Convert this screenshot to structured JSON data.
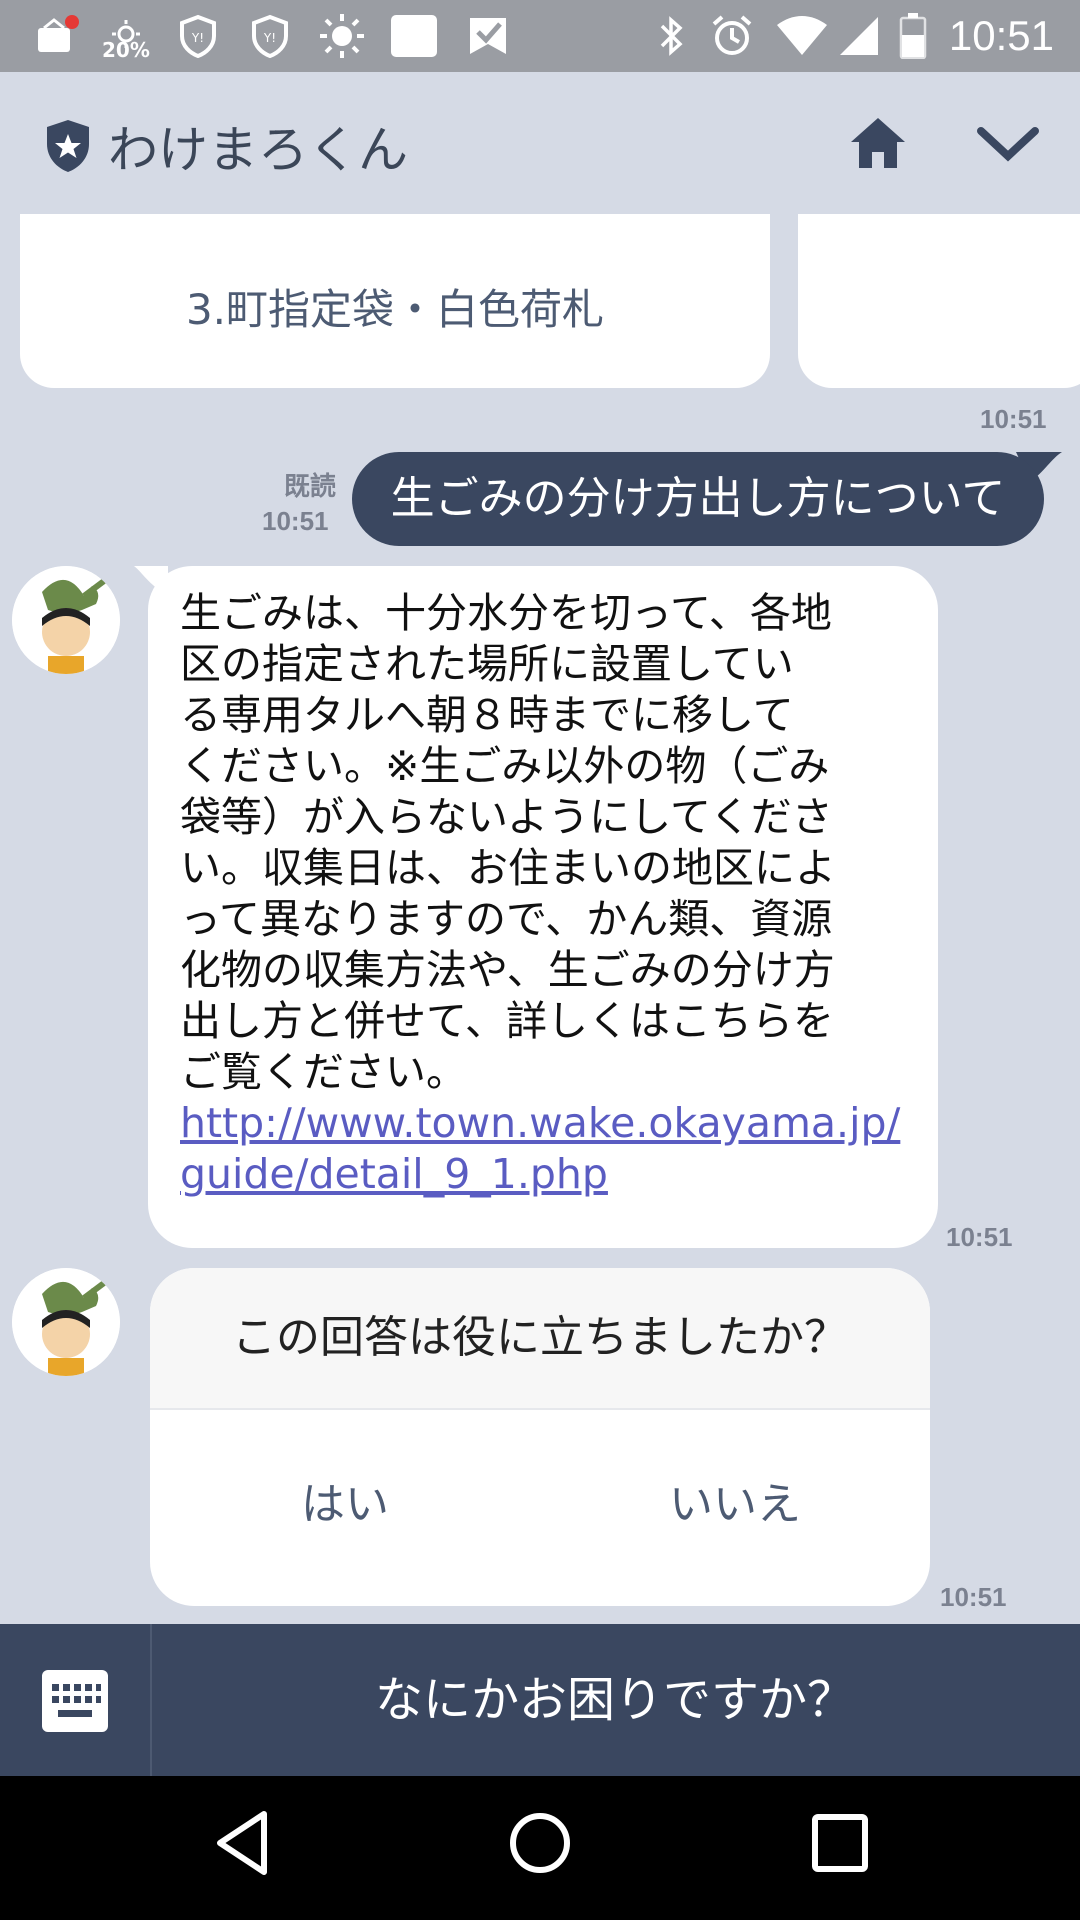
{
  "status_bar": {
    "battery_text": "20%",
    "time": "10:51"
  },
  "header": {
    "title": "わけまろくん"
  },
  "carousel": {
    "items": [
      {
        "label": "3.町指定袋・白色荷札"
      },
      {
        "label": ""
      }
    ],
    "time": "10:51"
  },
  "messages": {
    "outgoing": {
      "read_label": "既読",
      "time": "10:51",
      "text": "生ごみの分け方出し方について"
    },
    "incoming": {
      "text": "生ごみは、十分水分を切って、各地\n区の指定された場所に設置してい\nる専用タルへ朝８時までに移して\nください。※生ごみ以外の物（ごみ\n袋等）が入らないようにしてくださ\nい。収集日は、お住まいの地区によ\nって異なりますので、かん類、資源\n化物の収集方法や、生ごみの分け方\n出し方と併せて、詳しくはこちらを\nご覧ください。",
      "link_line1": "http://www.town.wake.okayama.jp/",
      "link_line2": "guide/detail_9_1.php",
      "time": "10:51"
    },
    "survey": {
      "question": "この回答は役に立ちましたか？",
      "yes": "はい",
      "no": "いいえ",
      "time": "10:51"
    }
  },
  "input_bar": {
    "prompt": "なにかお困りですか？"
  },
  "colors": {
    "accent": "#3a4760",
    "background": "#d5dae5",
    "link": "#5a5cc2"
  }
}
